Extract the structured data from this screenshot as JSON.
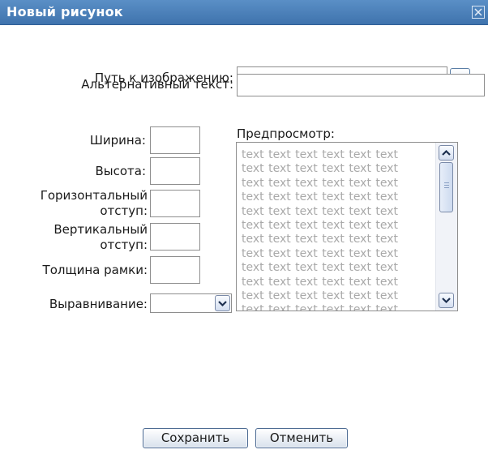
{
  "dialog": {
    "title": "Новый рисунок"
  },
  "labels": {
    "image_path": "Путь к изображению:",
    "alt_text": "Альтернативный текст:",
    "width": "Ширина:",
    "height": "Высота:",
    "hspace_line1": "Горизонтальный",
    "hspace_line2": "отступ:",
    "vspace_line1": "Вертикальный",
    "vspace_line2": "отступ:",
    "border": "Толщина рамки:",
    "align": "Выравнивание:",
    "preview": "Предпросмотр:"
  },
  "fields": {
    "image_path": "",
    "alt_text": "",
    "width": "",
    "height": "",
    "hspace": "",
    "vspace": "",
    "border": "",
    "align": ""
  },
  "browse_label": "...",
  "preview_lines": [
    "text text text text text text",
    "text text text text text text",
    "text text text text text text",
    "text text text text text text",
    "text text text text text text",
    "text text text text text text",
    "text text text text text text",
    "text text text text text text",
    "text text text text text text",
    "text text text text text text",
    "text text text text text text",
    "text text text text text text"
  ],
  "buttons": {
    "save": "Сохранить",
    "cancel": "Отменить"
  },
  "colors": {
    "titlebar": "#4a80bb",
    "preview_text": "#a9a9a9"
  },
  "icons": {
    "close": "close-icon",
    "scroll_up": "arrow-up-icon",
    "scroll_down": "arrow-down-icon",
    "dropdown": "chevron-down-icon"
  }
}
